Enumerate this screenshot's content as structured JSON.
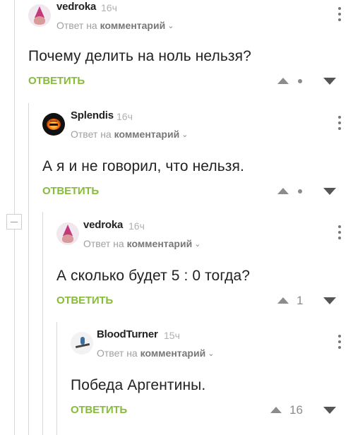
{
  "comments": [
    {
      "author": "vedroka",
      "age": "16ч",
      "reply_prefix": "Ответ на",
      "reply_target": "комментарий",
      "text": "Почему делить на ноль нельзя?",
      "reply_label": "ОТВЕТИТЬ",
      "rating": "",
      "avatar_icon": "troll-avatar-icon"
    },
    {
      "author": "Splendis",
      "age": "16ч",
      "reply_prefix": "Ответ на",
      "reply_target": "комментарий",
      "text": "А я и не говорил, что нельзя.",
      "reply_label": "ОТВЕТИТЬ",
      "rating": "",
      "avatar_icon": "pumpkin-avatar-icon"
    },
    {
      "author": "vedroka",
      "age": "16ч",
      "reply_prefix": "Ответ на",
      "reply_target": "комментарий",
      "text": "А сколько будет 5 : 0 тогда?",
      "reply_label": "ОТВЕТИТЬ",
      "rating": "1",
      "avatar_icon": "troll-avatar-icon"
    },
    {
      "author": "BloodTurner",
      "age": "15ч",
      "reply_prefix": "Ответ на",
      "reply_target": "комментарий",
      "text": "Победа Аргентины.",
      "reply_label": "ОТВЕТИТЬ",
      "rating": "16",
      "avatar_icon": "rider-avatar-icon"
    }
  ],
  "colors": {
    "reply_green": "#87bb3a",
    "muted_gray": "#a0a0a0",
    "thread_line": "#d8d8d8"
  }
}
